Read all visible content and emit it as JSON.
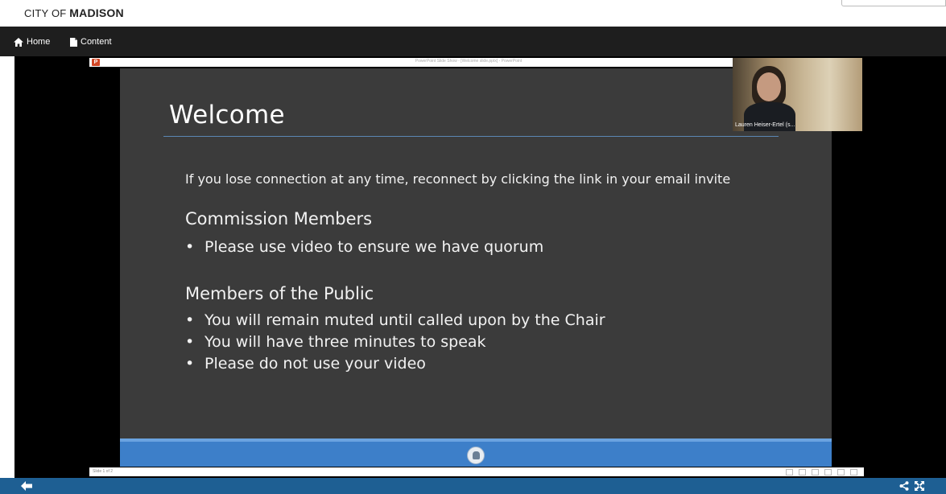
{
  "brand": {
    "prefix": "CITY OF",
    "name": "MADISON"
  },
  "nav": {
    "items": [
      {
        "label": "Home",
        "icon": "home-icon"
      },
      {
        "label": "Content",
        "icon": "document-icon"
      }
    ]
  },
  "powerpoint": {
    "window_title": "PowerPoint Slide Show - [Welcome slide.pptx] - PowerPoint",
    "slide_counter": "Slide 1 of 2"
  },
  "slide": {
    "title": "Welcome",
    "intro": "If you lose connection at any time, reconnect by clicking the link in your email invite",
    "sections": [
      {
        "heading": "Commission Members",
        "bullets": [
          "Please use video to ensure we have quorum"
        ]
      },
      {
        "heading": "Members of the Public",
        "bullets": [
          "You will remain muted until called upon by the Chair",
          "You will have three minutes to speak",
          "Please do not use your video"
        ]
      }
    ],
    "bullet_char": "•"
  },
  "webcam": {
    "participant": "Lauren Heiser-Ertel (s..."
  },
  "colors": {
    "nav_bg": "#1e1e1e",
    "slide_bg": "#3b3b3b",
    "slide_footer": "#3d7fc9",
    "bottom_bar": "#1e5f93"
  }
}
